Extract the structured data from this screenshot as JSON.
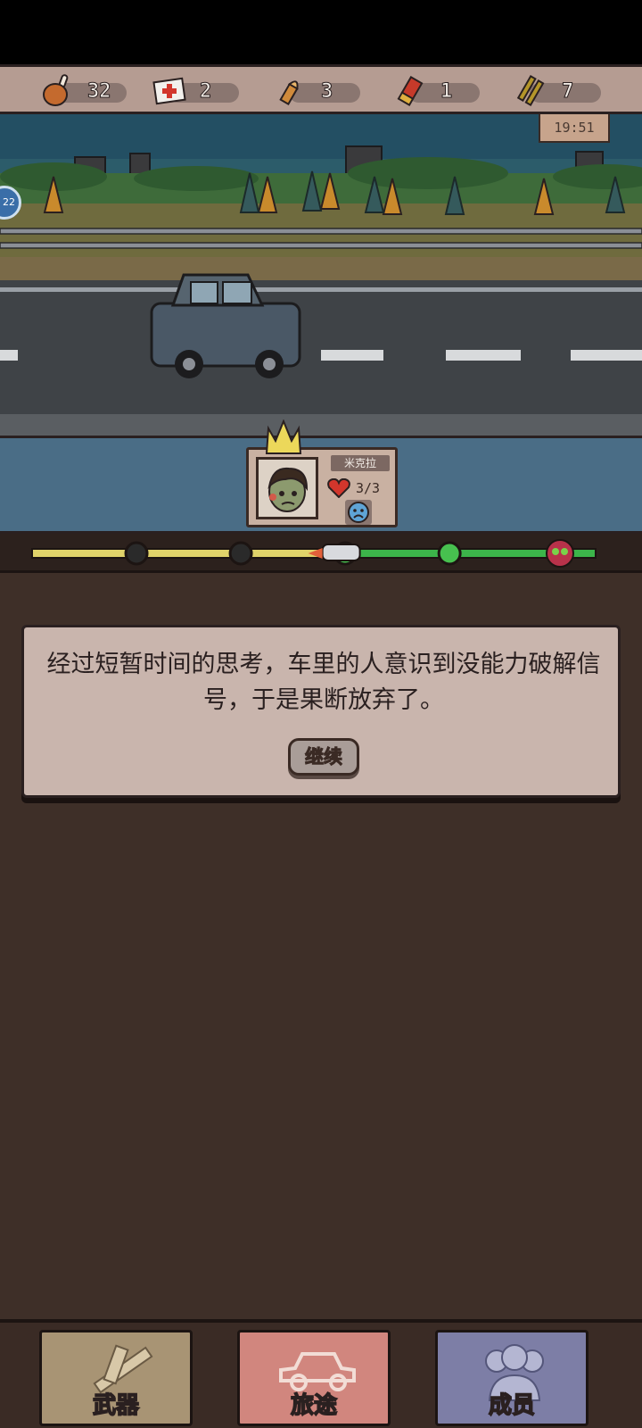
{
  "resources": [
    {
      "icon": "meat-drumstick-icon",
      "value": "32"
    },
    {
      "icon": "medkit-icon",
      "value": "2"
    },
    {
      "icon": "bullet-icon",
      "value": "3"
    },
    {
      "icon": "shotgun-shell-icon",
      "value": "1"
    },
    {
      "icon": "rifle-ammo-icon",
      "value": "7"
    }
  ],
  "scene": {
    "time": "19:51",
    "side_badge": "22"
  },
  "party": {
    "members": [
      {
        "name": "米克拉",
        "hp": "3/3",
        "mood": "sad-face-icon"
      }
    ]
  },
  "journey": {
    "progress": 0.55,
    "checkpoints": 4,
    "end_icon": "skull-icon"
  },
  "dialog": {
    "text": "经过短暂时间的思考，车里的人意识到没能力破解信号，于是果断放弃了。",
    "continue_label": "继续"
  },
  "nav": {
    "weapons_label": "武器",
    "journey_label": "旅途",
    "members_label": "成员"
  },
  "colors": {
    "progress_done": "#e0d36a",
    "progress_todo": "#3cb44a",
    "panel_blue": "#4a6d86",
    "tab_weapons": "#a89474",
    "tab_journey": "#d1867e",
    "tab_members": "#7d7ea6"
  }
}
